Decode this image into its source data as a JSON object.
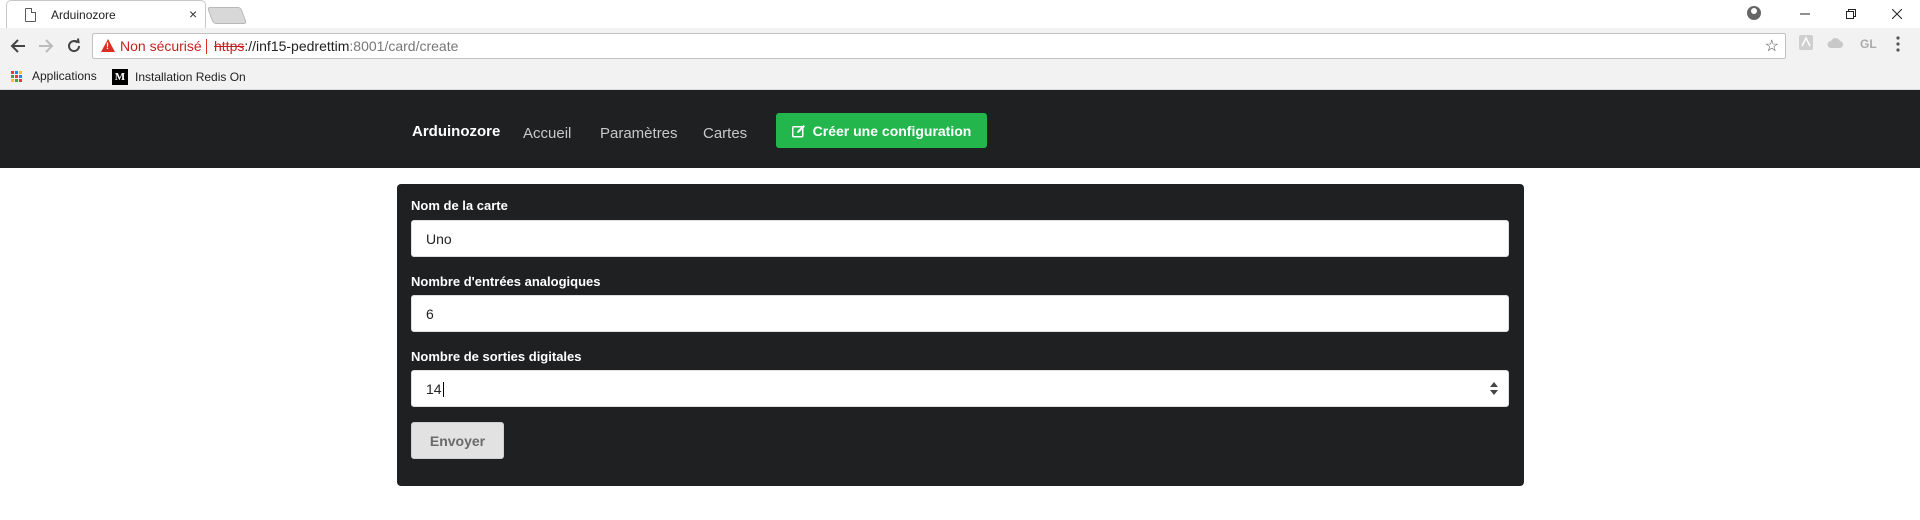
{
  "browser": {
    "tab_title": "Arduinozore",
    "tab_close": "×",
    "security_label": "Non sécurisé",
    "url_scheme": "https",
    "url_host": "://inf15-pedrettim",
    "url_path": ":8001/card/create",
    "extension_label": "GL",
    "bookmarks": [
      {
        "label": "Applications"
      },
      {
        "label": "Installation Redis On"
      }
    ],
    "medium_letter": "M"
  },
  "navbar": {
    "brand": "Arduinozore",
    "links": [
      "Accueil",
      "Paramètres",
      "Cartes"
    ],
    "create_button": "Créer une configuration",
    "accent_color": "#23b64c"
  },
  "form": {
    "fields": [
      {
        "label": "Nom de la carte",
        "value": "Uno"
      },
      {
        "label": "Nombre d'entrées analogiques",
        "value": "6"
      },
      {
        "label": "Nombre de sorties digitales",
        "value": "14"
      }
    ],
    "submit_label": "Envoyer"
  }
}
